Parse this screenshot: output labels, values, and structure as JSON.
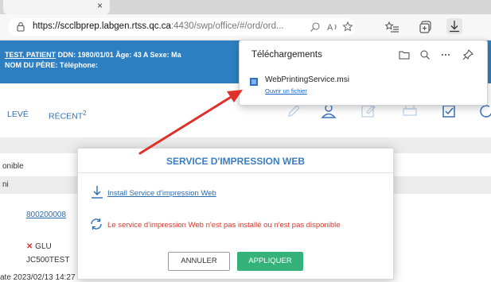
{
  "browser": {
    "url_host": "https://scclbprep.labgen.rtss.qc.ca",
    "url_rest": ":4430/swp/office/#/ord/ord...",
    "tab_close": "×"
  },
  "header": {
    "line1_name": "TEST, PATIENT",
    "line1_rest": "  DDN: 1980/01/01   Âge: 43 A   Sexe: Ma",
    "line2": "NOM DU PÈRE:   Téléphone:"
  },
  "nav": {
    "item_left": "LEVÉ",
    "item_recent": "RÉCENT",
    "recent_badge": "2"
  },
  "content": {
    "row1": "onible",
    "row2": "ni",
    "link_id": "800200008",
    "x_mark": "✕",
    "glu": "GLU",
    "jc": "JC500TEST",
    "bottom_row": "ate   2023/02/13 14:27"
  },
  "downloads": {
    "title": "Téléchargements",
    "filename": "WebPrintingService.msi",
    "open_link": "Ouvrir un fichier"
  },
  "modal": {
    "title": "SERVICE D'IMPRESSION WEB",
    "install_link": "Install Service d'impression Web",
    "error_text": "Le service d'impression Web n'est pas installé ou n'est pas disponible",
    "cancel_label": "ANNULER",
    "apply_label": "APPLIQUER"
  },
  "colors": {
    "header_bg": "#2d7fc1",
    "apply_green": "#35b27a",
    "error_red": "#d9372c",
    "annotation_arrow": "#e0302a"
  }
}
